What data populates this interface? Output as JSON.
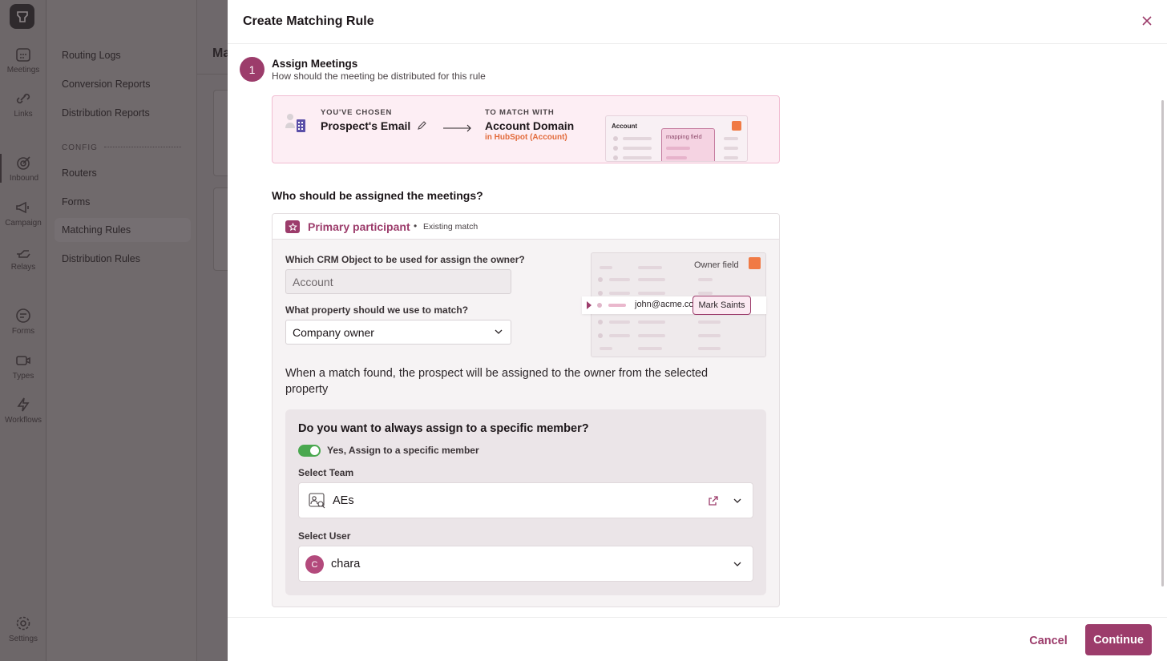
{
  "rail": {
    "items": [
      {
        "label": "Meetings",
        "icon": "calendar-icon"
      },
      {
        "label": "Links",
        "icon": "link-icon"
      },
      {
        "label": "Inbound",
        "icon": "target-icon"
      },
      {
        "label": "Campaign",
        "icon": "megaphone-icon"
      },
      {
        "label": "Relays",
        "icon": "relay-hand-icon"
      },
      {
        "label": "Forms",
        "icon": "form-icon"
      },
      {
        "label": "Types",
        "icon": "video-icon"
      },
      {
        "label": "Workflows",
        "icon": "lightning-icon"
      },
      {
        "label": "Settings",
        "icon": "gear-icon"
      }
    ]
  },
  "subnav": {
    "items": [
      "Routing Logs",
      "Conversion Reports",
      "Distribution Reports",
      "Routers",
      "Forms",
      "Matching Rules",
      "Distribution Rules"
    ],
    "section_label": "CONFIG"
  },
  "main": {
    "title": "Ma"
  },
  "modal": {
    "title": "Create Matching Rule",
    "step": {
      "number": "1",
      "title": "Assign Meetings",
      "subtitle": "How should the meeting be distributed for this rule"
    },
    "chosen": {
      "chosen_label": "YOU'VE CHOSEN",
      "chosen_value": "Prospect's Email",
      "match_label": "TO MATCH WITH",
      "match_value": "Account Domain",
      "match_source": "in HubSpot (Account)",
      "preview_title": "Account",
      "preview_field": "mapping field"
    },
    "question": "Who should be assigned the meetings?",
    "participant": {
      "name": "Primary participant",
      "bullet": "•",
      "status": "Existing match",
      "crm_label": "Which CRM Object to be used for assign the owner?",
      "crm_value": "Account",
      "property_label": "What property should we use to match?",
      "property_value": "Company owner",
      "preview_owner_field": "Owner field",
      "preview_email": "john@acme.co",
      "preview_owner": "Mark Saints",
      "explain": "When a match found, the prospect will be assigned to the owner from the selected property"
    },
    "specific": {
      "title": "Do you want to always assign to a specific member?",
      "toggle_label": "Yes, Assign to a specific member",
      "toggle_on": true,
      "team_label": "Select Team",
      "team_value": "AEs",
      "user_label": "Select User",
      "user_initial": "C",
      "user_value": "chara"
    },
    "footer": {
      "cancel": "Cancel",
      "continue": "Continue"
    }
  },
  "colors": {
    "accent": "#9c3c6b",
    "toggle_on": "#4aa84f",
    "hubspot": "#f07a45"
  }
}
